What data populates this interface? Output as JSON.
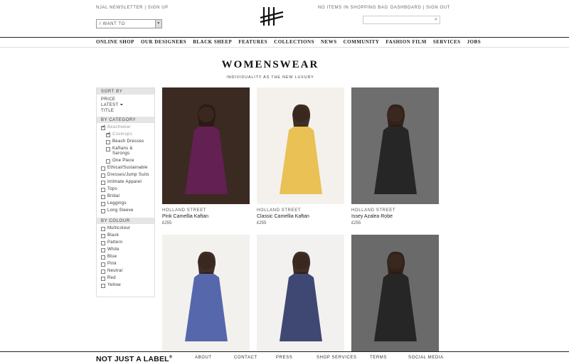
{
  "header": {
    "newsletter_link": "NJAL NEWSLETTER",
    "sep": "|",
    "signup_link": "SIGN UP",
    "bag_status": "NO ITEMS IN SHOPPING BAG",
    "dashboard_link": "DASHBOARD",
    "signout_link": "SIGN OUT",
    "iwant_select": "I WANT TO",
    "caret": "▾",
    "search_icon": "⌕"
  },
  "nav": [
    "ONLINE SHOP",
    "OUR DESIGNERS",
    "BLACK SHEEP",
    "FEATURES",
    "COLLECTIONS",
    "NEWS",
    "COMMUNITY",
    "FASHION FILM",
    "SERVICES",
    "JOBS"
  ],
  "page": {
    "title": "WOMENSWEAR",
    "subtitle": "INDIVIDUALITY AS THE NEW LUXURY"
  },
  "sidebar": {
    "sort_heading": "SORT BY",
    "sort_options": [
      "PRICE",
      "LATEST",
      "TITLE"
    ],
    "sort_arrow": "⏷",
    "category_heading": "BY CATEGORY",
    "categories": [
      {
        "label": "Beachwear",
        "checked": true,
        "sub": false
      },
      {
        "label": "Coverups",
        "checked": true,
        "sub": true
      },
      {
        "label": "Beach Dresses",
        "checked": false,
        "sub": true
      },
      {
        "label": "Kaftans & Sarongs",
        "checked": false,
        "sub": true
      },
      {
        "label": "One Piece",
        "checked": false,
        "sub": true
      },
      {
        "label": "Ethical/Sustainable",
        "checked": false,
        "sub": false
      },
      {
        "label": "Dresses/Jump Suits",
        "checked": false,
        "sub": false
      },
      {
        "label": "Intimate Apparel",
        "checked": false,
        "sub": false
      },
      {
        "label": "Tops",
        "checked": false,
        "sub": false
      },
      {
        "label": "Bridal",
        "checked": false,
        "sub": false
      },
      {
        "label": "Leggings",
        "checked": false,
        "sub": false
      },
      {
        "label": "Long Sleeve",
        "checked": false,
        "sub": false
      }
    ],
    "colour_heading": "BY COLOUR",
    "colours": [
      "Multicolour",
      "Black",
      "Pattern",
      "White",
      "Blue",
      "Pink",
      "Neutral",
      "Red",
      "Yellow"
    ]
  },
  "products": [
    {
      "brand": "HOLLAND STREET",
      "name": "Pink Camellia Kaftan",
      "price": "£255",
      "bg": "#3b2a22",
      "accent": "#6b1f5a"
    },
    {
      "brand": "HOLLAND STREET",
      "name": "Classic Camellia Kaftan",
      "price": "£255",
      "bg": "#f4f1ec",
      "accent": "#e6b83a"
    },
    {
      "brand": "HOLLAND STREET",
      "name": "Issey Azalea Robe",
      "price": "£255",
      "bg": "#6e6e6e",
      "accent": "#1a1a1a"
    },
    {
      "brand": "",
      "name": "",
      "price": "",
      "bg": "#f3f1ee",
      "accent": "#3a4fa0"
    },
    {
      "brand": "",
      "name": "",
      "price": "",
      "bg": "#f2f1ef",
      "accent": "#1f2a5c"
    },
    {
      "brand": "",
      "name": "",
      "price": "",
      "bg": "#6a6a6a",
      "accent": "#1a1a1a"
    }
  ],
  "footer": {
    "logo": "NOT JUST A LABEL",
    "logo_mark": "®",
    "links": [
      "ABOUT",
      "CONTACT",
      "PRESS",
      "SHOP SERVICES",
      "TERMS",
      "SOCIAL MEDIA"
    ]
  }
}
